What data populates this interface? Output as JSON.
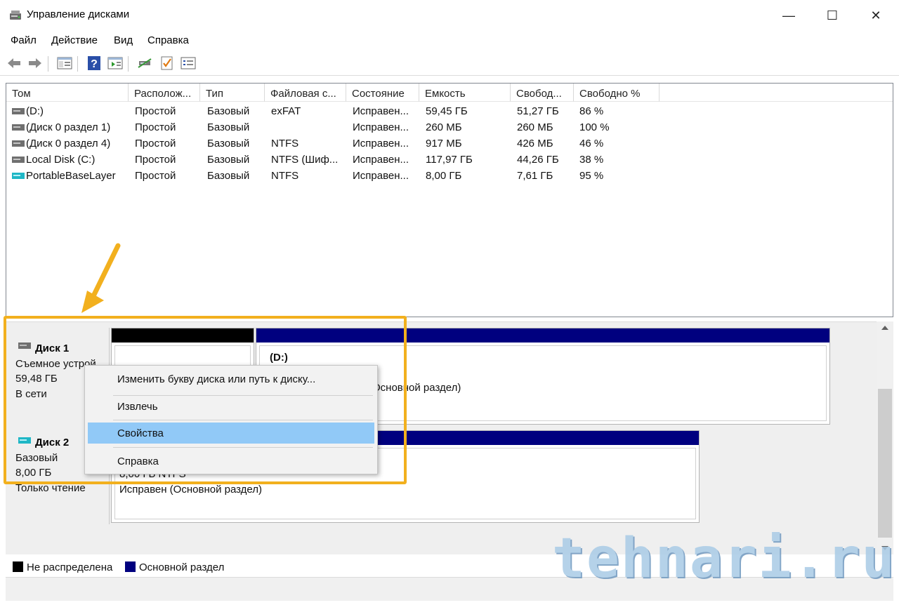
{
  "window": {
    "title": "Управление дисками",
    "minimize_glyph": "—",
    "maximize_glyph": "☐",
    "close_glyph": "✕"
  },
  "menubar": [
    "Файл",
    "Действие",
    "Вид",
    "Справка"
  ],
  "toolbar": {
    "icons": [
      "back-arrow-icon",
      "forward-arrow-icon",
      "console-tree-icon",
      "help-icon",
      "action-pane-icon",
      "connect-icon",
      "check-icon",
      "properties-list-icon"
    ]
  },
  "volume_list": {
    "columns": [
      "Том",
      "Располож...",
      "Тип",
      "Файловая с...",
      "Состояние",
      "Емкость",
      "Свобод...",
      "Свободно %"
    ],
    "rows": [
      {
        "name": " (D:)",
        "layout": "Простой",
        "type": "Базовый",
        "fs": "exFAT",
        "status": "Исправен...",
        "capacity": "59,45 ГБ",
        "free": "51,27 ГБ",
        "free_pct": "86 %",
        "icon": "drive-gray-icon"
      },
      {
        "name": "(Диск 0 раздел 1)",
        "layout": "Простой",
        "type": "Базовый",
        "fs": "",
        "status": "Исправен...",
        "capacity": "260 МБ",
        "free": "260 МБ",
        "free_pct": "100 %",
        "icon": "drive-gray-icon"
      },
      {
        "name": "(Диск 0 раздел 4)",
        "layout": "Простой",
        "type": "Базовый",
        "fs": "NTFS",
        "status": "Исправен...",
        "capacity": "917 МБ",
        "free": "426 МБ",
        "free_pct": "46 %",
        "icon": "drive-gray-icon"
      },
      {
        "name": "Local Disk (C:)",
        "layout": "Простой",
        "type": "Базовый",
        "fs": "NTFS (Шиф...",
        "status": "Исправен...",
        "capacity": "117,97 ГБ",
        "free": "44,26 ГБ",
        "free_pct": "38 %",
        "icon": "drive-gray-icon"
      },
      {
        "name": "PortableBaseLayer",
        "layout": "Простой",
        "type": "Базовый",
        "fs": "NTFS",
        "status": "Исправен...",
        "capacity": "8,00 ГБ",
        "free": "7,61 ГБ",
        "free_pct": "95 %",
        "icon": "drive-cyan-icon"
      }
    ]
  },
  "disks": [
    {
      "title": "Диск 1",
      "lines": [
        "Съемное устрой",
        "59,48 ГБ",
        "В сети"
      ],
      "partition": {
        "label": "(D:)",
        "detail": "Основной раздел)"
      }
    },
    {
      "title": "Диск 2",
      "lines": [
        "Базовый",
        "8,00 ГБ",
        "Только чтение"
      ],
      "partition": {
        "size_line": "8,00 ГБ NTFS",
        "status_line": "Исправен (Основной раздел)"
      }
    }
  ],
  "legend": [
    {
      "label": "Не распределена",
      "color": "#000000"
    },
    {
      "label": "Основной раздел",
      "color": "#00007f"
    }
  ],
  "context_menu": {
    "items": [
      {
        "label": "Изменить букву диска или путь к диску..."
      },
      {
        "label": "Извлечь"
      },
      {
        "label": "Свойства",
        "active": true
      },
      {
        "label": "Справка"
      }
    ]
  },
  "watermark": "tehnari.ru",
  "colors": {
    "highlight": "#f2b01e",
    "primary_partition": "#00007f",
    "unallocated": "#000000",
    "menu_selection": "#91c9f7"
  }
}
